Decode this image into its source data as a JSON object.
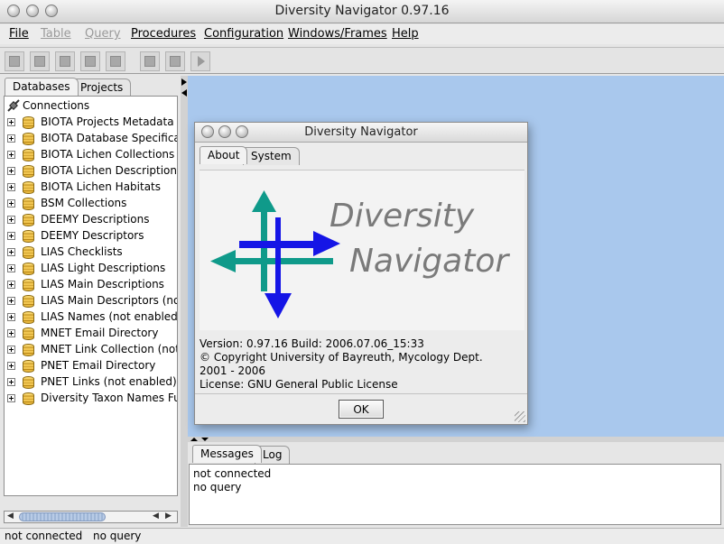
{
  "window": {
    "title": "Diversity Navigator 0.97.16"
  },
  "menu": {
    "file": "File",
    "table": "Table",
    "query": "Query",
    "procedures": "Procedures",
    "configuration": "Configuration",
    "windows": "Windows/Frames",
    "help": "Help"
  },
  "toolbar": {
    "buttons": [
      "new-table-icon",
      "insert-row-icon",
      "table-icon",
      "delete-row-icon",
      "save-icon",
      "open-folder-icon",
      "save-query-icon",
      "run-icon"
    ]
  },
  "left_panel": {
    "tabs": [
      "Databases",
      "Projects"
    ],
    "tree_root": "Connections",
    "items": [
      "BIOTA Projects Metadata",
      "BIOTA Database Specificat",
      "BIOTA Lichen Collections",
      "BIOTA Lichen Descriptions",
      "BIOTA Lichen Habitats",
      "BSM Collections",
      "DEEMY Descriptions",
      "DEEMY Descriptors",
      "LIAS Checklists",
      "LIAS Light Descriptions",
      "LIAS Main Descriptions",
      "LIAS Main Descriptors (not",
      "LIAS Names (not enabled)",
      "MNET Email Directory",
      "MNET Link Collection (not",
      "PNET Email Directory",
      "PNET Links (not enabled)",
      "Diversity Taxon Names Fu"
    ]
  },
  "about_dialog": {
    "title": "Diversity Navigator",
    "tabs": [
      "About",
      "System"
    ],
    "logo_line1": "Diversity",
    "logo_line2": "Navigator",
    "version": "Version: 0.97.16 Build: 2006.07.06_15:33",
    "copyright": "© Copyright  University of Bayreuth, Mycology Dept.",
    "years": "2001 - 2006",
    "license": "License: GNU General Public License",
    "ok": "OK"
  },
  "messages_panel": {
    "tabs": [
      "Messages",
      "Log"
    ],
    "lines": [
      "not connected",
      "no query"
    ]
  },
  "status": {
    "connection": "not connected",
    "query": "no query"
  },
  "colors": {
    "desktop": "#a9c8ed",
    "logo_teal": "#0f9a8a",
    "logo_blue": "#1515e6",
    "logo_text": "#7a7a7a"
  }
}
